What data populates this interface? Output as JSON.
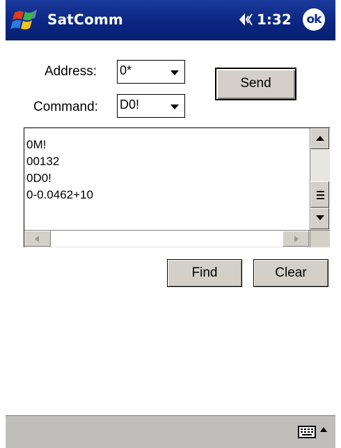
{
  "titlebar": {
    "app_title": "SatComm",
    "time": "1:32",
    "ok_label": "ok"
  },
  "form": {
    "address_label": "Address:",
    "address_value": "0*",
    "command_label": "Command:",
    "command_value": "D0!",
    "send_label": "Send"
  },
  "log": {
    "lines": [
      "0M!",
      "00132",
      "0D0!",
      "0-0.0462+10"
    ]
  },
  "actions": {
    "find_label": "Find",
    "clear_label": "Clear"
  },
  "icons": {
    "start": "windows-flag-icon",
    "speaker": "speaker-icon",
    "keyboard": "keyboard-icon",
    "sip": "chevron-up-icon"
  },
  "colors": {
    "titlebar": "#0a2580",
    "button_face": "#d4d0c8",
    "bottombar": "#c0bebb"
  }
}
